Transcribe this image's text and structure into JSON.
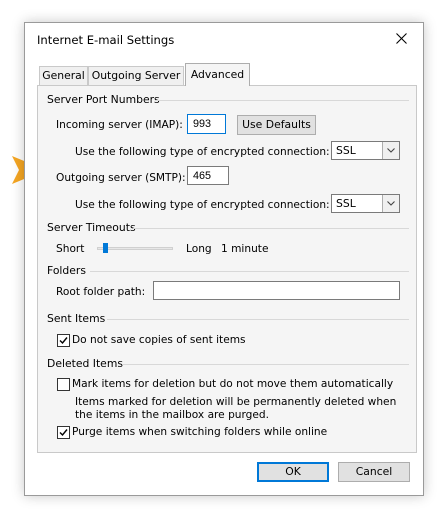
{
  "dialog": {
    "title": "Internet E-mail Settings",
    "close_icon": "close-icon"
  },
  "tabs": [
    {
      "label": "General",
      "active": false
    },
    {
      "label": "Outgoing Server",
      "active": false
    },
    {
      "label": "Advanced",
      "active": true
    }
  ],
  "server_ports": {
    "heading": "Server Port Numbers",
    "incoming_label": "Incoming server (IMAP):",
    "incoming_value": "993",
    "use_defaults_label": "Use Defaults",
    "incoming_encryption_label": "Use the following type of encrypted connection:",
    "incoming_encryption_value": "SSL",
    "outgoing_label": "Outgoing server (SMTP):",
    "outgoing_value": "465",
    "outgoing_encryption_label": "Use the following type of encrypted connection:",
    "outgoing_encryption_value": "SSL"
  },
  "timeouts": {
    "heading": "Server Timeouts",
    "short_label": "Short",
    "long_label": "Long",
    "value": "1 minute",
    "slider_level": 0.08
  },
  "folders": {
    "heading": "Folders",
    "root_path_label": "Root folder path:",
    "root_path_value": ""
  },
  "sent_items": {
    "heading": "Sent Items",
    "no_copies_label": "Do not save copies of sent items",
    "no_copies_checked": true
  },
  "deleted_items": {
    "heading": "Deleted Items",
    "mark_label": "Mark items for deletion but do not move them automatically",
    "mark_checked": false,
    "note_line1": "Items marked for deletion will be permanently deleted when",
    "note_line2": "the items in the mailbox are purged.",
    "purge_label": "Purge items when switching folders while online",
    "purge_checked": true
  },
  "footer": {
    "ok_label": "OK",
    "cancel_label": "Cancel"
  },
  "colors": {
    "accent": "#0078d7",
    "callout_arrow": "#f5a623"
  }
}
